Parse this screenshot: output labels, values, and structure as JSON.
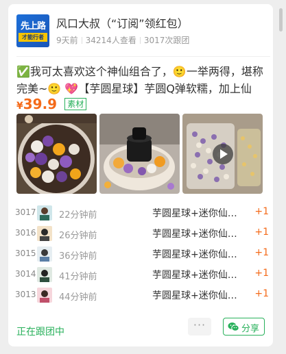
{
  "header": {
    "logo_line1": "先上路",
    "logo_line2": "才能行者",
    "title": "风口大叔（“订阅”领红包）",
    "days_ago": "9天前",
    "views": "34214人查看",
    "group_count": "3017次跟团"
  },
  "post": {
    "description": "✅我可太喜欢这个神仙组合了，🙂一举两得，堪称完美~🙂 💖【芋圆星球】芋圆Q弹软糯，加上仙草…",
    "price_symbol": "¥",
    "price": "39.9",
    "tag": "素材"
  },
  "images": [
    {
      "name": "taro-balls-bowl-image"
    },
    {
      "name": "dessert-with-grass-jelly-image"
    },
    {
      "name": "packaged-taro-balls-video"
    }
  ],
  "followers": [
    {
      "num": "3017",
      "time": "22分钟前",
      "product": "芋圆星球+迷你仙草冻",
      "qty": "+1"
    },
    {
      "num": "3016",
      "time": "26分钟前",
      "product": "芋圆星球+迷你仙草冻",
      "qty": "+1"
    },
    {
      "num": "3015",
      "time": "36分钟前",
      "product": "芋圆星球+迷你仙草冻",
      "qty": "+1"
    },
    {
      "num": "3014",
      "time": "41分钟前",
      "product": "芋圆星球+迷你仙草冻",
      "qty": "+1"
    },
    {
      "num": "3013",
      "time": "44分钟前",
      "product": "芋圆星球+迷你仙草冻",
      "qty": "+1"
    }
  ],
  "footer": {
    "status": "正在跟团中",
    "more": "···",
    "share": "分享"
  },
  "colors": {
    "accent_green": "#27b05a",
    "price_orange": "#f46a19"
  }
}
